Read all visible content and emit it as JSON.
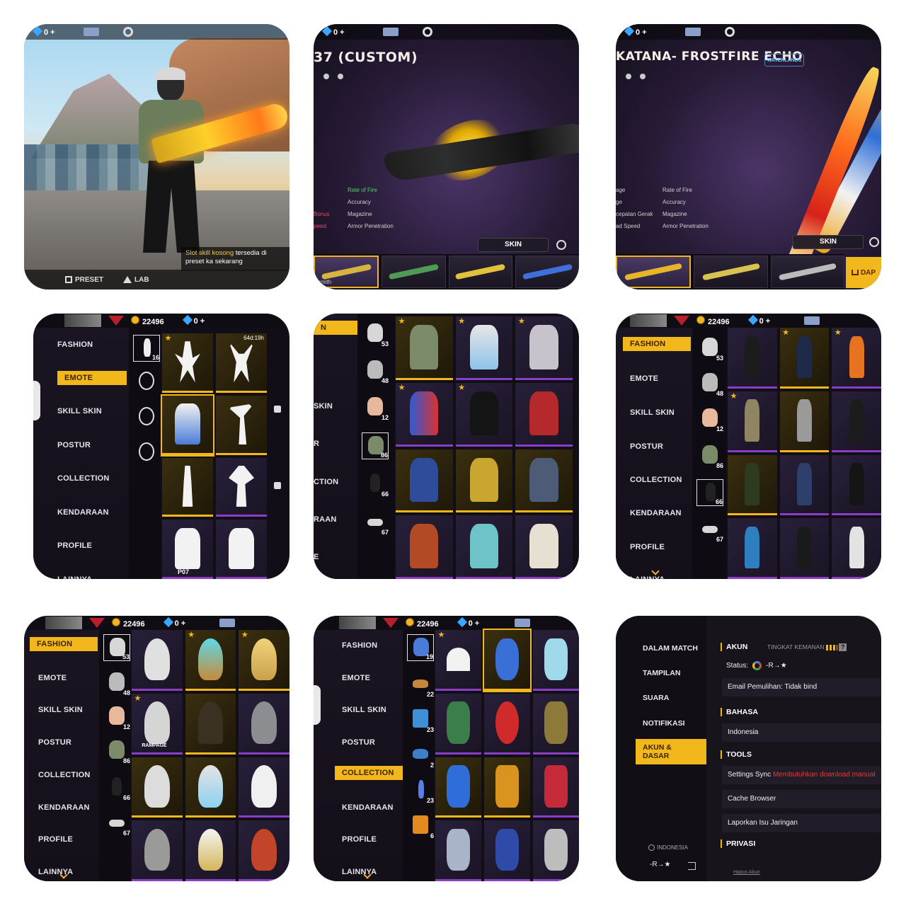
{
  "hud": {
    "coins": "22496",
    "diamonds": "0 +",
    "diamonds_top": "0 +"
  },
  "tile1": {
    "tooltip_highlight": "Slot skill kosong",
    "tooltip_rest": " tersedia di preset ka sekarang",
    "preset_label": "PRESET",
    "lab_label": "LAB"
  },
  "tile2": {
    "title": "37 (CUSTOM)",
    "stats_right": [
      "Rate of Fire",
      "Accuracy",
      "Magazine",
      "Armor Penetration"
    ],
    "stats_left": [
      "",
      "",
      "Bonus",
      "peed"
    ],
    "skin_label": "SKIN",
    "slot_caption": "smith"
  },
  "tile3": {
    "title": "KATANA- FROSTFIRE ECHO",
    "badge": "WATERLANDS",
    "stats_left": [
      "age",
      "ge",
      "cepatan Gerak",
      "ad Speed"
    ],
    "stats_right": [
      "Rate of Fire",
      "Accuracy",
      "Magazine",
      "Armor Penetration"
    ],
    "skin_label": "SKIN",
    "shop_label": "DAP"
  },
  "menu": {
    "fashion": "FASHION",
    "emote": "EMOTE",
    "skill_skin": "SKILL SKIN",
    "postur": "POSTUR",
    "collection": "COLLECTION",
    "kendaraan": "KENDARAAN",
    "profile": "PROFILE",
    "lainnya": "LAINNYA"
  },
  "tile4": {
    "timer": "64d:19h",
    "sub_num": "16",
    "cell_num": "P07"
  },
  "tile5": {
    "side_partial": [
      "N",
      "SKIN",
      "R",
      "CTION",
      "RAAN",
      "E"
    ],
    "sub_nums": [
      "53",
      "48",
      "12",
      "86",
      "66",
      "67"
    ]
  },
  "tile6": {
    "sub_nums": [
      "53",
      "48",
      "12",
      "86",
      "66",
      "67"
    ]
  },
  "tile7": {
    "sub_nums": [
      "53",
      "48",
      "12",
      "86",
      "66",
      "67"
    ],
    "cell_label": "RAMPAGE"
  },
  "tile8": {
    "sub_nums": [
      "19",
      "22",
      "23",
      "2",
      "23",
      "6"
    ]
  },
  "tile9": {
    "menu": [
      "DALAM MATCH",
      "TAMPILAN",
      "SUARA",
      "NOTIFIKASI",
      "AKUN & DASAR"
    ],
    "akun_label": "AKUN",
    "security_label": "TINGKAT KEMANAN",
    "status_label": "Status:",
    "status_value": "-R→★",
    "email_row": "Email Pemulihan: Tidak bind",
    "bahasa_label": "BAHASA",
    "bahasa_value": "Indonesia",
    "tools_label": "TOOLS",
    "settings_sync": "Settings Sync",
    "settings_sync_warn": "Membutuhkan download manual",
    "cache_browser": "Cache Browser",
    "laporkan": "Laporkan Isu Jaringan",
    "privasi_label": "PRIVASI",
    "region": "INDONESIA",
    "user_name": "-R→★",
    "hapus_akun": "Hapus Akun"
  },
  "colors": {
    "accent": "#f2b71b",
    "epic": "#8a3ec8",
    "warning": "#e53935"
  }
}
